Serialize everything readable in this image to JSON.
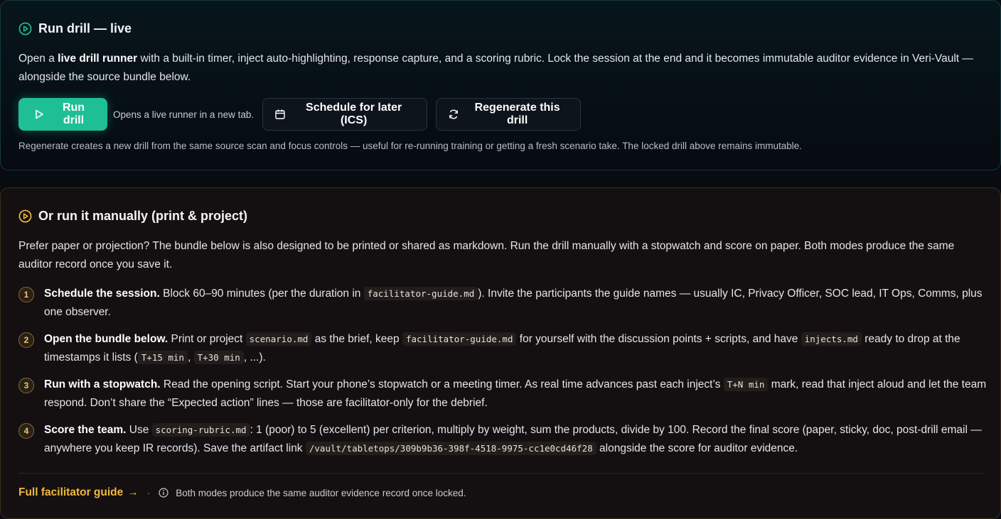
{
  "live": {
    "title": "Run drill — live",
    "desc_prefix": "Open a ",
    "desc_bold": "live drill runner",
    "desc_suffix": " with a built-in timer, inject auto-highlighting, response capture, and a scoring rubric. Lock the session at the end and it becomes immutable auditor evidence in Veri-Vault — alongside the source bundle below.",
    "run_label": "Run drill",
    "run_hint": "Opens a live runner in a new tab.",
    "schedule_label": "Schedule for later (ICS)",
    "regen_label": "Regenerate this drill",
    "regen_note": "Regenerate creates a new drill from the same source scan and focus controls — useful for re-running training or getting a fresh scenario take. The locked drill above remains immutable.",
    "accent": "#1fbf96"
  },
  "manual": {
    "title": "Or run it manually (print & project)",
    "desc": "Prefer paper or projection? The bundle below is also designed to be printed or shared as markdown. Run the drill manually with a stopwatch and score on paper. Both modes produce the same auditor record once you save it.",
    "accent": "#f0b83d",
    "steps": [
      {
        "num": "1",
        "bold": "Schedule the session.",
        "t1": " Block 60–90 minutes (per the duration in ",
        "c1": "facilitator-guide.md",
        "t2": "). Invite the participants the guide names — usually IC, Privacy Officer, SOC lead, IT Ops, Comms, plus one observer."
      },
      {
        "num": "2",
        "bold": "Open the bundle below.",
        "t1": " Print or project ",
        "c1": "scenario.md",
        "t2": " as the brief, keep ",
        "c2": "facilitator-guide.md",
        "t3": " for yourself with the discussion points + scripts, and have ",
        "c3": "injects.md",
        "t4": " ready to drop at the timestamps it lists (",
        "c4": "T+15 min",
        "t5": ", ",
        "c5": "T+30 min",
        "t6": ", ...)."
      },
      {
        "num": "3",
        "bold": "Run with a stopwatch.",
        "t1": " Read the opening script. Start your phone’s stopwatch or a meeting timer. As real time advances past each inject’s ",
        "c1": "T+N min",
        "t2": " mark, read that inject aloud and let the team respond. Don’t share the “Expected action” lines — those are facilitator-only for the debrief."
      },
      {
        "num": "4",
        "bold": "Score the team.",
        "t1": " Use ",
        "c1": "scoring-rubric.md",
        "t2": ": 1 (poor) to 5 (excellent) per criterion, multiply by weight, sum the products, divide by 100. Record the final score (paper, sticky, doc, post-drill email — anywhere you keep IR records). Save the artifact link ",
        "c2": "/vault/tabletops/309b9b36-398f-4518-9975-cc1e0cd46f28",
        "t3": " alongside the score for auditor evidence."
      }
    ],
    "footer_link": "Full facilitator guide",
    "footer_arrow": "→",
    "footer_sep": "·",
    "footer_note": "Both modes produce the same auditor evidence record once locked."
  }
}
